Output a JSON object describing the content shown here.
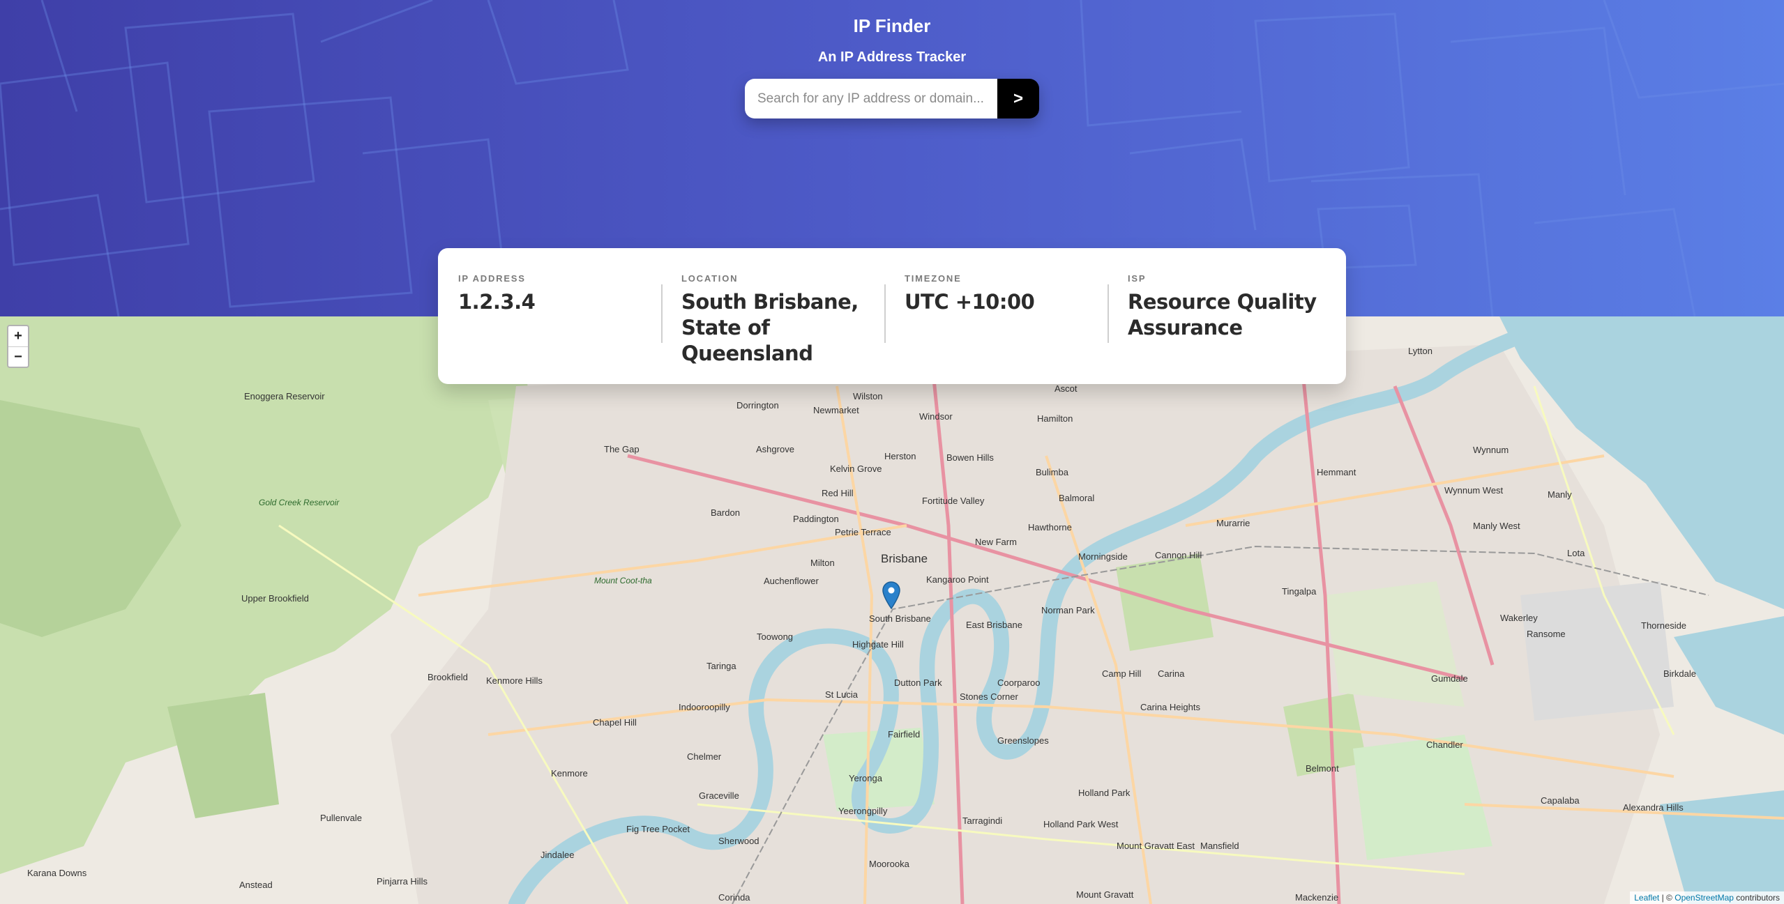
{
  "app": {
    "title": "IP Finder",
    "subtitle": "An IP Address Tracker"
  },
  "search": {
    "placeholder": "Search for any IP address or domain...",
    "value": "",
    "submit_label": ">"
  },
  "info": {
    "ip": {
      "label": "IP ADDRESS",
      "value": "1.2.3.4"
    },
    "location": {
      "label": "LOCATION",
      "value": "South Brisbane, State of Queensland"
    },
    "timezone": {
      "label": "TIMEZONE",
      "value": "UTC +10:00"
    },
    "isp": {
      "label": "ISP",
      "value": "Resource Quality Assurance"
    }
  },
  "map": {
    "zoom_in": "+",
    "zoom_out": "−",
    "attribution": {
      "leaflet": "Leaflet",
      "separator": "| ©",
      "osm": "OpenStreetMap",
      "contributors": "contributors"
    },
    "place_labels": [
      "Enoggera Reservoir",
      "The Gap",
      "Ashgrove",
      "Kelvin Grove",
      "Red Hill",
      "Bardon",
      "Paddington",
      "Petrie Terrace",
      "Brisbane",
      "Milton",
      "Auchenflower",
      "Kangaroo Point",
      "South Brisbane",
      "East Brisbane",
      "Highgate Hill",
      "Toowong",
      "Taringa",
      "St Lucia",
      "Dutton Park",
      "Stones Corner",
      "Coorparoo",
      "Norman Park",
      "Camp Hill",
      "Carina",
      "Carina Heights",
      "Greenslopes",
      "Fairfield",
      "Indooroopilly",
      "Chapel Hill",
      "Kenmore",
      "Kenmore Hills",
      "Brookfield",
      "Upper Brookfield",
      "Chelmer",
      "Yeronga",
      "Graceville",
      "Yeerongpilly",
      "Sherwood",
      "Fig Tree Pocket",
      "Jindalee",
      "Moorooka",
      "Tarragindi",
      "Holland Park",
      "Holland Park West",
      "Mount Gravatt East",
      "Mansfield",
      "Belmont",
      "Chandler",
      "Gumdale",
      "Capalaba",
      "Alexandra Hills",
      "Birkdale",
      "Thorneside",
      "Wakerley",
      "Ransome",
      "Manly West",
      "Manly",
      "Lota",
      "Wynnum West",
      "Wynnum",
      "Hemmant",
      "Murarrie",
      "Cannon Hill",
      "Morningside",
      "Balmoral",
      "Hawthorne",
      "Bulimba",
      "New Farm",
      "Fortitude Valley",
      "Bowen Hills",
      "Herston",
      "Windsor",
      "Wilston",
      "Newmarket",
      "Dorrington",
      "Hamilton",
      "Ascot",
      "Lytton",
      "Tingalpa",
      "Pullenvale",
      "Karana Downs",
      "Anstead",
      "Pinjarra Hills",
      "Mount Coot-tha",
      "Gold Creek Reservoir",
      "Mount Gravatt",
      "Corinda",
      "Mackenzie",
      "Windsor"
    ]
  }
}
